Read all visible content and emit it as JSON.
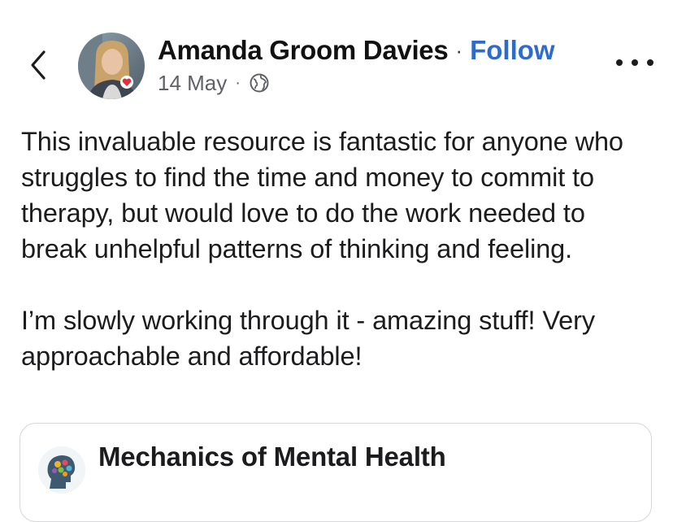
{
  "post": {
    "author_name": "Amanda Groom Davies",
    "separator": "·",
    "follow_label": "Follow",
    "date": "14 May",
    "meta_separator": "·",
    "audience_icon": "globe-icon",
    "paragraphs": [
      "This invaluable resource is fantastic for anyone who struggles to find the time and money to commit to therapy, but would love to do the work needed to break unhelpful patterns of thinking and feeling.",
      "I’m slowly working through it - amazing stuff! Very approachable and affordable!"
    ]
  },
  "header": {
    "back_icon": "chevron-left-icon",
    "more_icon": "more-horizontal-icon"
  },
  "shared_card": {
    "title": "Mechanics of Mental Health",
    "logo_icon": "head-gears-logo"
  },
  "colors": {
    "link": "#2f6cc9",
    "text": "#1c1c1e",
    "meta": "#5f6166",
    "border": "#d6d6d8"
  }
}
